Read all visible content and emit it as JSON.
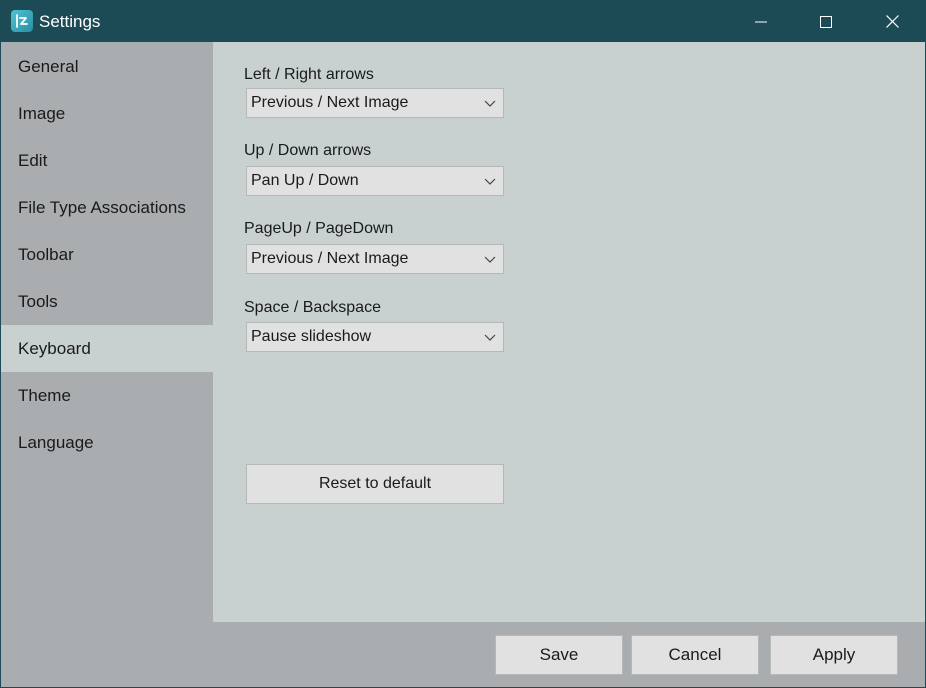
{
  "window": {
    "title": "Settings",
    "app_icon": "imageglass-icon",
    "controls": [
      "minimize-icon",
      "maximize-icon",
      "close-icon"
    ]
  },
  "colors": {
    "titlebar": "#1c4a55",
    "sidebar": "#a9adaf",
    "content": "#c9d1d0",
    "button": "#e1e1e1"
  },
  "sidebar": {
    "items": [
      {
        "label": "General"
      },
      {
        "label": "Image"
      },
      {
        "label": "Edit"
      },
      {
        "label": "File Type Associations"
      },
      {
        "label": "Toolbar"
      },
      {
        "label": "Tools"
      },
      {
        "label": "Keyboard"
      },
      {
        "label": "Theme"
      },
      {
        "label": "Language"
      }
    ],
    "selected": "Keyboard"
  },
  "keyboard": {
    "fields": [
      {
        "label": "Left / Right arrows",
        "value": "Previous / Next Image"
      },
      {
        "label": "Up / Down arrows",
        "value": "Pan Up / Down"
      },
      {
        "label": "PageUp / PageDown",
        "value": "Previous / Next Image"
      },
      {
        "label": "Space / Backspace",
        "value": "Pause slideshow"
      }
    ],
    "reset_label": "Reset to default"
  },
  "footer": {
    "save_label": "Save",
    "cancel_label": "Cancel",
    "apply_label": "Apply"
  }
}
